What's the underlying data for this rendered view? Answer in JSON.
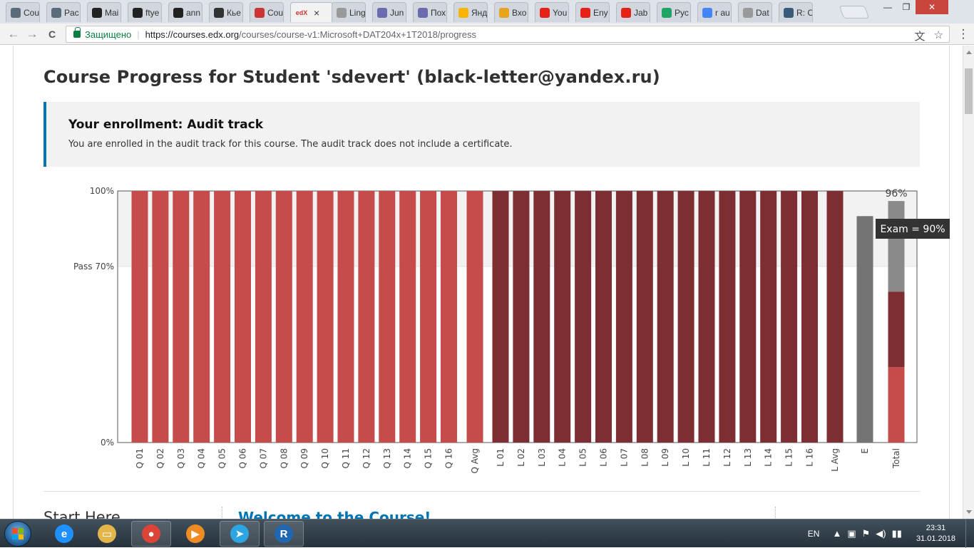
{
  "browser": {
    "tabs": [
      {
        "label": "Cou",
        "icon": "edx-r-icon",
        "color": "#5a6b7a"
      },
      {
        "label": "Pac",
        "icon": "edx-r-icon",
        "color": "#5a6b7a"
      },
      {
        "label": "Mai",
        "icon": "github-icon",
        "color": "#222222"
      },
      {
        "label": "ftye",
        "icon": "github-icon",
        "color": "#222222"
      },
      {
        "label": "ann",
        "icon": "github-icon",
        "color": "#222222"
      },
      {
        "label": "Кье",
        "icon": "owl-icon",
        "color": "#333333"
      },
      {
        "label": "Cou",
        "icon": "edx-icon",
        "color": "#c33"
      },
      {
        "label": "",
        "icon": "edx-icon",
        "color": "#c33",
        "active": true
      },
      {
        "label": "Ling",
        "icon": "page-icon",
        "color": "#999999"
      },
      {
        "label": "Jun",
        "icon": "person-icon",
        "color": "#6b6bb0"
      },
      {
        "label": "Пох",
        "icon": "person-icon",
        "color": "#6b6bb0"
      },
      {
        "label": "Янд",
        "icon": "music-icon",
        "color": "#f8b400"
      },
      {
        "label": "Вхо",
        "icon": "mail-icon",
        "color": "#e8a41d"
      },
      {
        "label": "You",
        "icon": "youtube-icon",
        "color": "#e62117"
      },
      {
        "label": "Eny",
        "icon": "youtube-icon",
        "color": "#e62117"
      },
      {
        "label": "Jab",
        "icon": "youtube-icon",
        "color": "#e62117"
      },
      {
        "label": "Рус",
        "icon": "drive-icon",
        "color": "#1fa463"
      },
      {
        "label": "r au",
        "icon": "google-icon",
        "color": "#4285f4"
      },
      {
        "label": "Dat",
        "icon": "page-icon",
        "color": "#999999"
      },
      {
        "label": "R: C",
        "icon": "r-icon",
        "color": "#3a5a7a"
      }
    ],
    "active_tab_glyph": "edX",
    "close_glyph": "×",
    "secure_label": "Защищено",
    "url_host": "https://courses.edx.org",
    "url_path": "/courses/course-v1:Microsoft+DAT204x+1T2018/progress",
    "back_glyph": "←",
    "forward_glyph": "→",
    "reload_glyph": "C",
    "translate_glyph": "文",
    "star_glyph": "☆",
    "menu_glyph": "⋮",
    "window_controls": {
      "minimize": "—",
      "maximize": "❐",
      "close": "✕"
    }
  },
  "page": {
    "title": "Course Progress for Student 'sdevert' (black-letter@yandex.ru)",
    "enrollment_title": "Your enrollment: Audit track",
    "enrollment_text": "You are enrolled in the audit track for this course. The audit track does not include a certificate.",
    "section_left": "Start Here",
    "section_main": "Welcome to the Course!"
  },
  "chart_data": {
    "type": "bar",
    "categories": [
      "Q 01",
      "Q 02",
      "Q 03",
      "Q 04",
      "Q 05",
      "Q 06",
      "Q 07",
      "Q 08",
      "Q 09",
      "Q 10",
      "Q 11",
      "Q 12",
      "Q 13",
      "Q 14",
      "Q 15",
      "Q 16",
      "Q Avg",
      "L 01",
      "L 02",
      "L 03",
      "L 04",
      "L 05",
      "L 06",
      "L 07",
      "L 08",
      "L 09",
      "L 10",
      "L 11",
      "L 12",
      "L 13",
      "L 14",
      "L 15",
      "L 16",
      "L Avg",
      "E",
      "Total"
    ],
    "series": [
      {
        "values": [
          100,
          100,
          100,
          100,
          100,
          100,
          100,
          100,
          100,
          100,
          100,
          100,
          100,
          100,
          100,
          100,
          100
        ],
        "color": "#c64b4b"
      },
      {
        "values": [
          100,
          100,
          100,
          100,
          100,
          100,
          100,
          100,
          100,
          100,
          100,
          100,
          100,
          100,
          100,
          100,
          100
        ],
        "color": "#7d2e32"
      },
      {
        "values": [
          90
        ],
        "color": "#737373"
      }
    ],
    "total": {
      "value": 96,
      "label": "96%",
      "segments": [
        {
          "value": 30,
          "color": "#c64b4b"
        },
        {
          "value": 30,
          "color": "#7d2e32"
        },
        {
          "value": 36,
          "color": "#8a8a8a"
        }
      ]
    },
    "y_ticks": [
      "0%",
      "Pass 70%",
      "100%"
    ],
    "pass_line": 70,
    "ylim": [
      0,
      100
    ],
    "tooltip": "Exam = 90%"
  },
  "taskbar": {
    "apps": [
      {
        "name": "ie-icon",
        "glyph": "e",
        "color": "#1e90ff"
      },
      {
        "name": "explorer-icon",
        "glyph": "▭",
        "color": "#e3b54a"
      },
      {
        "name": "chrome-icon",
        "glyph": "●",
        "color": "#db4437",
        "open": true
      },
      {
        "name": "media-player-icon",
        "glyph": "▶",
        "color": "#f08a24"
      },
      {
        "name": "telegram-icon",
        "glyph": "➤",
        "color": "#2ca5e0",
        "open": true
      },
      {
        "name": "r-icon",
        "glyph": "R",
        "color": "#2166b0",
        "open": true
      }
    ],
    "lang": "EN",
    "tray_glyphs": [
      "▲",
      "▣",
      "⚑",
      "◀)",
      "▮▮"
    ],
    "time": "23:31",
    "date": "31.01.2018"
  }
}
